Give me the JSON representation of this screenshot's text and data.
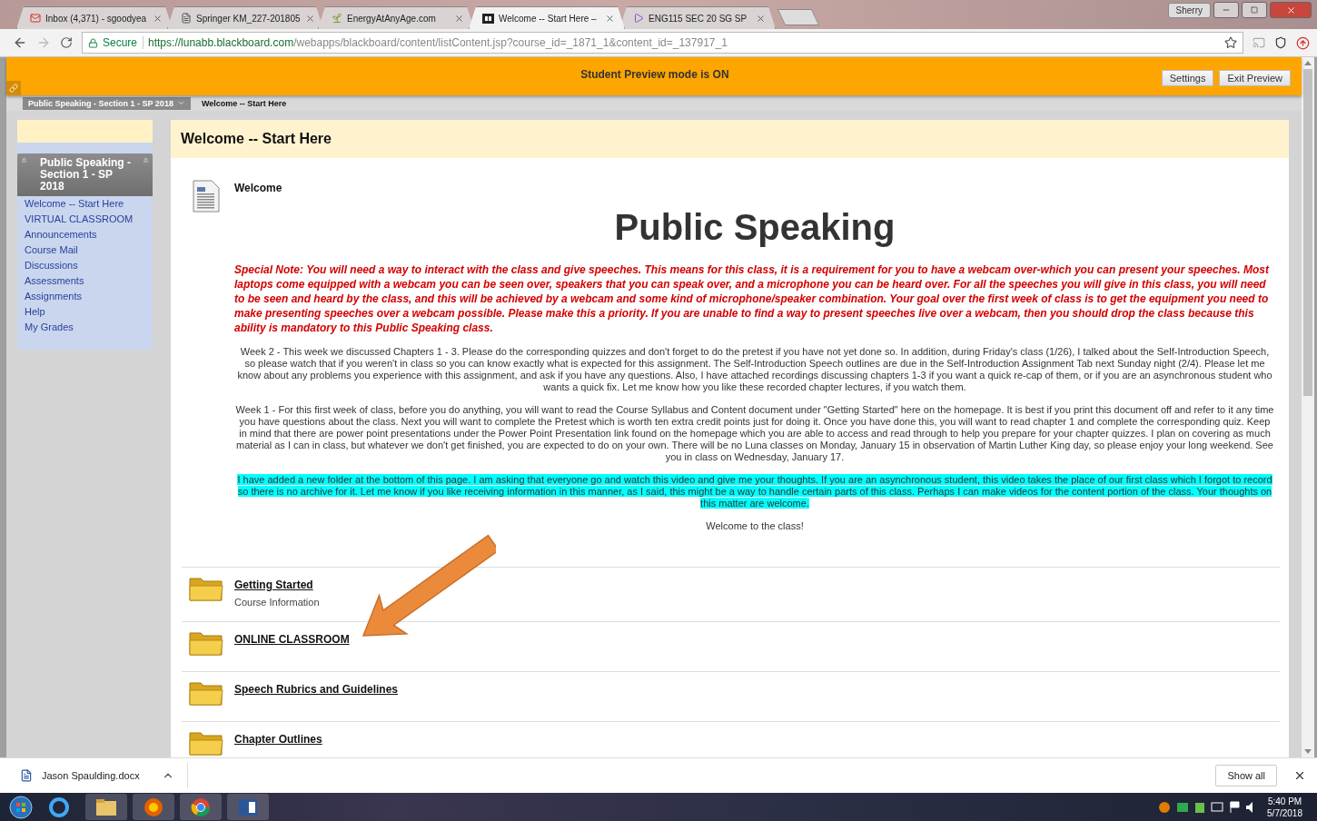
{
  "browser": {
    "tabs": [
      {
        "title": "Inbox (4,371) - sgoodyea",
        "selected": false
      },
      {
        "title": "Springer KM_227-201805",
        "selected": false
      },
      {
        "title": "EnergyAtAnyAge.com",
        "selected": false
      },
      {
        "title": "Welcome -- Start Here –",
        "selected": true
      },
      {
        "title": "ENG115 SEC 20 SG SP",
        "selected": false
      }
    ],
    "profile": "Sherry",
    "secure_label": "Secure",
    "url_host": "https://lunabb.blackboard.com",
    "url_path": "/webapps/blackboard/content/listContent.jsp?course_id=_1871_1&content_id=_137917_1"
  },
  "preview_bar": {
    "message": "Student Preview mode is ON",
    "buttons": [
      "Settings",
      "Exit Preview"
    ]
  },
  "breadcrumb": [
    "Public Speaking - Section 1 - SP 2018",
    "Welcome -- Start Here"
  ],
  "sidebar": {
    "course_title": "Public Speaking - Section 1 - SP 2018",
    "items": [
      "Welcome -- Start Here",
      "VIRTUAL CLASSROOM",
      "Announcements",
      "Course Mail",
      "Discussions",
      "Assessments",
      "Assignments",
      "Help",
      "My Grades"
    ]
  },
  "content": {
    "title": "Welcome -- Start Here",
    "item_title": "Welcome",
    "heading": "Public Speaking",
    "paragraphs": [
      {
        "kind": "note",
        "text": "Special Note:  You will need a way to interact with the class and give speeches.  This means for this class, it is a requirement for you to have a webcam over-which you can present your speeches.  Most laptops come equipped with a webcam you can be seen over, speakers that you can speak over, and a microphone you can be heard over.  For all the speeches you will give in this class, you will need to be seen and heard by the class, and this will be achieved by a webcam and some kind of microphone/speaker combination.  Your goal over the first week of class is to get the equipment you need to make presenting speeches over a webcam possible.  Please make this a priority. If you are unable to find a way to present speeches live over a webcam, then you should drop the class because this ability is mandatory to this Public Speaking class."
      },
      {
        "kind": "plain",
        "text": "Week 2 - This week we discussed Chapters 1 - 3.  Please do the corresponding quizzes and don't forget to do the pretest if you have not yet done so.  In addition, during Friday's class (1/26), I talked about the Self-Introduction Speech, so please watch that if you weren't in class so you can know exactly what is expected for this assignment.  The Self-Introduction Speech outlines are due in the Self-Introduction Assignment Tab next Sunday night (2/4).  Please let me know about any problems you experience with this assignment, and ask if you have any questions.  Also, I have attached recordings discussing chapters 1-3 if you want a quick re-cap of them, or if you are an asynchronous student who wants a quick fix.  Let me know how you like these recorded chapter lectures, if you watch them."
      },
      {
        "kind": "plain",
        "text": "Week 1 - For this first week of class, before you do anything, you will want to read the Course Syllabus and Content document under \"Getting Started\" here on the homepage.  It is best if you print this document off and refer to it any time you have questions about the class.  Next you will want to complete the Pretest which is worth ten extra credit points just for doing it. Once you have done this, you will want to read chapter 1 and complete the corresponding quiz.  Keep in mind that there are power point presentations under the Power Point Presentation link found on the homepage which you are able to access and read through to help you prepare for your chapter quizzes.  I plan on covering as much material as I can in class, but whatever we don't get finished, you are expected to do on your own.  There will be no Luna classes on Monday, January 15 in observation of Martin Luther King day, so please enjoy your long weekend. See you in class on Wednesday, January 17."
      },
      {
        "kind": "highlight",
        "text": "I have added a new folder at the bottom of this page.  I am asking that everyone go and watch this video and give me your thoughts.  If you are an asynchronous student, this video takes the place of our first class which I forgot to record so there is no archive for it. Let me know if you like receiving information in this manner, as I said, this might be a way to handle certain parts of this class.  Perhaps I can make videos for the content portion of the class.  Your thoughts on this matter are welcome.  "
      },
      {
        "kind": "plain",
        "text": "Welcome to the class!"
      }
    ],
    "folders": [
      {
        "title": "Getting Started",
        "description": "Course Information"
      },
      {
        "title": "ONLINE CLASSROOM"
      },
      {
        "title": "Speech Rubrics and Guidelines"
      },
      {
        "title": "Chapter Outlines"
      }
    ]
  },
  "downloads": {
    "file": "Jason Spaulding.docx",
    "show_all": "Show all"
  },
  "taskbar": {
    "time": "5:40 PM",
    "date": "5/7/2018"
  }
}
